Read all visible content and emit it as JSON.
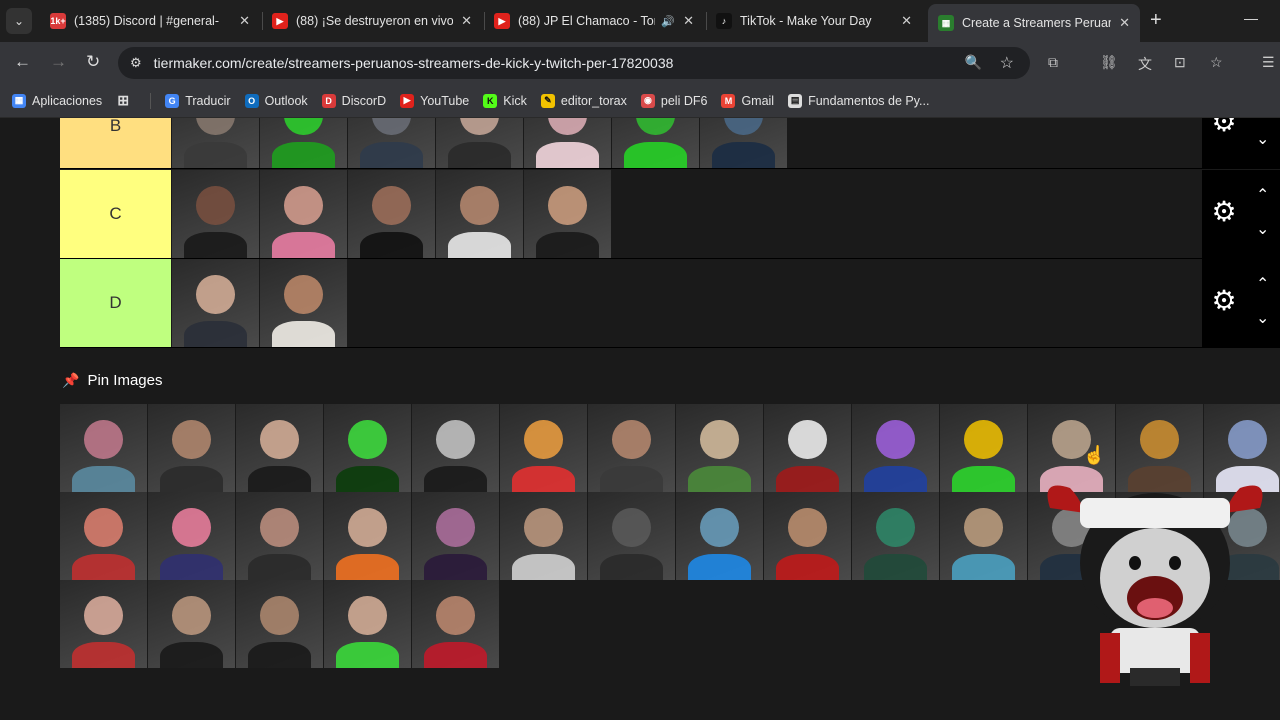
{
  "tabs": [
    {
      "title": "(1385) Discord | #general-",
      "favicon": "1k+",
      "color": "#d93a3a"
    },
    {
      "title": "(88) ¡Se destruyeron en vivo!",
      "favicon": "▶",
      "color": "#e0221c"
    },
    {
      "title": "(88) JP El Chamaco - Tor",
      "favicon": "▶",
      "color": "#e0221c"
    },
    {
      "title": "TikTok - Make Your Day",
      "favicon": "♪",
      "color": "#111111"
    },
    {
      "title": "Create a Streamers Peruanos",
      "favicon": "▦",
      "color": "#2a7d2e"
    }
  ],
  "address_bar": {
    "url": "tiermaker.com/create/streamers-peruanos-streamers-de-kick-y-twitch-per-17820038"
  },
  "bookmarks": [
    {
      "label": "Aplicaciones",
      "icon": "apps-grid-icon",
      "color": "#4285f4"
    },
    {
      "label": "Traducir",
      "icon": "translate-icon",
      "color": "#4285f4"
    },
    {
      "label": "Outlook",
      "icon": "outlook-icon",
      "color": "#0f6cbd"
    },
    {
      "label": "DiscorD",
      "icon": "discord-icon",
      "color": "#d93a3a"
    },
    {
      "label": "YouTube",
      "icon": "youtube-icon",
      "color": "#e0221c"
    },
    {
      "label": "Kick",
      "icon": "kick-icon",
      "color": "#53fc18"
    },
    {
      "label": "editor_torax",
      "icon": "editor-icon",
      "color": "#f2c200"
    },
    {
      "label": "peli DF6",
      "icon": "peli-icon",
      "color": "#d94a4a"
    },
    {
      "label": "Gmail",
      "icon": "gmail-icon",
      "color": "#ea4335"
    },
    {
      "label": "Fundamentos de Py...",
      "icon": "page-icon",
      "color": "#dddddd"
    }
  ],
  "tiers": [
    {
      "label": "B",
      "color": "#ffdf80",
      "item_count": 7,
      "tiles": [
        [
          "#8a7a70",
          "#3a3a3a"
        ],
        [
          "#2bd42b",
          "#1e9f1e"
        ],
        [
          "#6b6f78",
          "#2f3b4b"
        ],
        [
          "#c9a99a",
          "#2a2a2a"
        ],
        [
          "#e0b0b8",
          "#f2d5dc"
        ],
        [
          "#30c030",
          "#26d026"
        ],
        [
          "#4a6a8a",
          "#1b2c44"
        ]
      ]
    },
    {
      "label": "C",
      "color": "#ffff7f",
      "item_count": 5,
      "tiles": [
        [
          "#7a5040",
          "#1a1a1a"
        ],
        [
          "#d9a090",
          "#e87ca2"
        ],
        [
          "#a0705a",
          "#111111"
        ],
        [
          "#b88a70",
          "#e8e8e8"
        ],
        [
          "#d0a080",
          "#1a1a1a"
        ]
      ]
    },
    {
      "label": "D",
      "color": "#bfff7f",
      "item_count": 2,
      "tiles": [
        [
          "#d9b29a",
          "#2a2f38"
        ],
        [
          "#c08a6a",
          "#f0ece6"
        ]
      ]
    }
  ],
  "pin_images": {
    "title": "Pin Images"
  },
  "pool_tiles": [
    [
      "#c47a8e",
      "#5a8aa0"
    ],
    [
      "#b58a70",
      "#2b2b2b"
    ],
    [
      "#d9b29a",
      "#1a1a1a"
    ],
    [
      "#3de03d",
      "#0b3d0b"
    ],
    [
      "#c8c8c8",
      "#1a1a1a"
    ],
    [
      "#f0a040",
      "#e23030"
    ],
    [
      "#b88a70",
      "#3a3a3a"
    ],
    [
      "#d8c0a0",
      "#4a8a3a"
    ],
    [
      "#f4f4f4",
      "#a01a1a"
    ],
    [
      "#a060e0",
      "#2040a0"
    ],
    [
      "#f2c200",
      "#2bd42b"
    ],
    [
      "#c0a890",
      "#e8b0c0"
    ],
    [
      "#d09030",
      "#5a4030"
    ],
    [
      "#8aa0d0",
      "#e8e8f8"
    ],
    [
      "#e08070",
      "#c03030"
    ],
    [
      "#f080a0",
      "#303070"
    ],
    [
      "#c09080",
      "#2a2a2a"
    ],
    [
      "#d9b29a",
      "#f07020"
    ],
    [
      "#b070a0",
      "#2a1a3a"
    ],
    [
      "#c09a80",
      "#d0d0d0"
    ],
    [
      "#5a5a5a",
      "#2a2a2a"
    ],
    [
      "#6aa0c0",
      "#1e88e5"
    ],
    [
      "#c09070",
      "#c01a1a"
    ],
    [
      "#2e8a6a",
      "#204a3a"
    ],
    [
      "#c0a080",
      "#4aa0c0"
    ],
    [
      "#8a8a8a",
      "#203040"
    ],
    [
      "#dddddd",
      "#303030"
    ],
    [
      "#7a8a90",
      "#2a3a40"
    ],
    [
      "#e0b0a0",
      "#c03030"
    ],
    [
      "#c09a80",
      "#1a1a1a"
    ],
    [
      "#b08a70",
      "#1a1a1a"
    ],
    [
      "#d9b29a",
      "#3ad83a"
    ],
    [
      "#c08a70",
      "#c01a2a"
    ]
  ],
  "colors": {
    "accent_red": "#e44444",
    "mascot_red": "#b01818"
  }
}
